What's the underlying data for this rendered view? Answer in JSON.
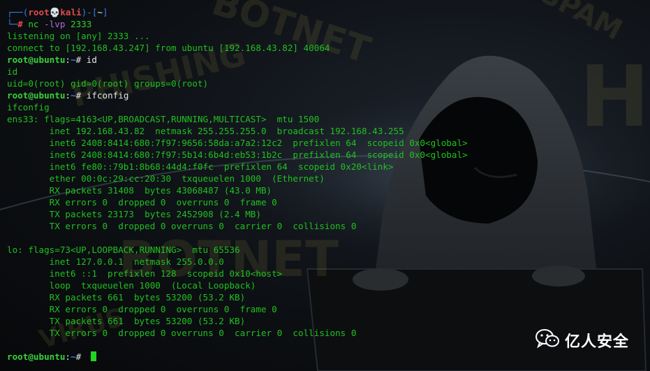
{
  "terminal": {
    "lines": [
      {
        "parts": [
          {
            "t": "┌──(",
            "c": "kb"
          },
          {
            "t": "root💀kali",
            "c": "kr"
          },
          {
            "t": ")-[",
            "c": "kb"
          },
          {
            "t": "~",
            "c": "w"
          },
          {
            "t": "]",
            "c": "kb"
          }
        ]
      },
      {
        "parts": [
          {
            "t": "└─",
            "c": "kb"
          },
          {
            "t": "# ",
            "c": "kr"
          },
          {
            "t": "nc ",
            "c": "cmd-nc"
          },
          {
            "t": "-lvp ",
            "c": "opt"
          },
          {
            "t": "2333",
            "c": "num"
          }
        ]
      },
      {
        "parts": [
          {
            "t": "listening on [any] 2333 ...",
            "c": ""
          }
        ]
      },
      {
        "parts": [
          {
            "t": "connect to [192.168.43.247] from ubuntu [192.168.43.82] 40064",
            "c": ""
          }
        ]
      },
      {
        "parts": [
          {
            "t": "root@ubuntu",
            "c": "ug"
          },
          {
            "t": ":",
            "c": "pw"
          },
          {
            "t": "~",
            "c": "ub"
          },
          {
            "t": "# id",
            "c": "pw"
          }
        ]
      },
      {
        "parts": [
          {
            "t": "id",
            "c": ""
          }
        ]
      },
      {
        "parts": [
          {
            "t": "uid=0(root) gid=0(root) groups=0(root)",
            "c": ""
          }
        ]
      },
      {
        "parts": [
          {
            "t": "root@ubuntu",
            "c": "ug"
          },
          {
            "t": ":",
            "c": "pw"
          },
          {
            "t": "~",
            "c": "ub"
          },
          {
            "t": "# ifconfig",
            "c": "pw"
          }
        ]
      },
      {
        "parts": [
          {
            "t": "ifconfig",
            "c": ""
          }
        ]
      },
      {
        "parts": [
          {
            "t": "ens33: flags=4163<UP,BROADCAST,RUNNING,MULTICAST>  mtu 1500",
            "c": ""
          }
        ]
      },
      {
        "parts": [
          {
            "t": "        inet 192.168.43.82  netmask 255.255.255.0  broadcast 192.168.43.255",
            "c": ""
          }
        ]
      },
      {
        "parts": [
          {
            "t": "        inet6 2408:8414:680:7f97:9656:58da:a7a2:12c2  prefixlen 64  scopeid 0x0<global>",
            "c": ""
          }
        ]
      },
      {
        "parts": [
          {
            "t": "        inet6 2408:8414:680:7f97:5b14:6b4d:eb53:1b2c  prefixlen 64  scopeid 0x0<global>",
            "c": ""
          }
        ]
      },
      {
        "parts": [
          {
            "t": "        inet6 fe80::79b1:8b68:44d4:f0fc  prefixlen 64  scopeid 0x20<link>",
            "c": ""
          }
        ]
      },
      {
        "parts": [
          {
            "t": "        ether 00:0c:29:cc:20:30  txqueuelen 1000  (Ethernet)",
            "c": ""
          }
        ]
      },
      {
        "parts": [
          {
            "t": "        RX packets 31408  bytes 43068487 (43.0 MB)",
            "c": ""
          }
        ]
      },
      {
        "parts": [
          {
            "t": "        RX errors 0  dropped 0  overruns 0  frame 0",
            "c": ""
          }
        ]
      },
      {
        "parts": [
          {
            "t": "        TX packets 23173  bytes 2452908 (2.4 MB)",
            "c": ""
          }
        ]
      },
      {
        "parts": [
          {
            "t": "        TX errors 0  dropped 0 overruns 0  carrier 0  collisions 0",
            "c": ""
          }
        ]
      },
      {
        "parts": [
          {
            "t": "",
            "c": ""
          }
        ]
      },
      {
        "parts": [
          {
            "t": "lo: flags=73<UP,LOOPBACK,RUNNING>  mtu 65536",
            "c": ""
          }
        ]
      },
      {
        "parts": [
          {
            "t": "        inet 127.0.0.1  netmask 255.0.0.0",
            "c": ""
          }
        ]
      },
      {
        "parts": [
          {
            "t": "        inet6 ::1  prefixlen 128  scopeid 0x10<host>",
            "c": ""
          }
        ]
      },
      {
        "parts": [
          {
            "t": "        loop  txqueuelen 1000  (Local Loopback)",
            "c": ""
          }
        ]
      },
      {
        "parts": [
          {
            "t": "        RX packets 661  bytes 53200 (53.2 KB)",
            "c": ""
          }
        ]
      },
      {
        "parts": [
          {
            "t": "        RX errors 0  dropped 0  overruns 0  frame 0",
            "c": ""
          }
        ]
      },
      {
        "parts": [
          {
            "t": "        TX packets 661  bytes 53200 (53.2 KB)",
            "c": ""
          }
        ]
      },
      {
        "parts": [
          {
            "t": "        TX errors 0  dropped 0 overruns 0  carrier 0  collisions 0",
            "c": ""
          }
        ]
      },
      {
        "parts": [
          {
            "t": "",
            "c": ""
          }
        ]
      },
      {
        "parts": [
          {
            "t": "root@ubuntu",
            "c": "ug"
          },
          {
            "t": ":",
            "c": "pw"
          },
          {
            "t": "~",
            "c": "ub"
          },
          {
            "t": "# ",
            "c": "pw"
          }
        ],
        "cursor": true
      }
    ]
  },
  "wallpaper": {
    "words": [
      "BOTNET",
      "SPAM",
      "PHISHING",
      "HA",
      "BOTNET",
      "VIRUS"
    ]
  },
  "watermark": {
    "icon": "wechat-icon",
    "text": "亿人安全"
  },
  "colors": {
    "output_green": "#20c020",
    "prompt_blue": "#3b7de8",
    "root_red": "#e24a4a",
    "option_purple": "#b06ad6"
  }
}
